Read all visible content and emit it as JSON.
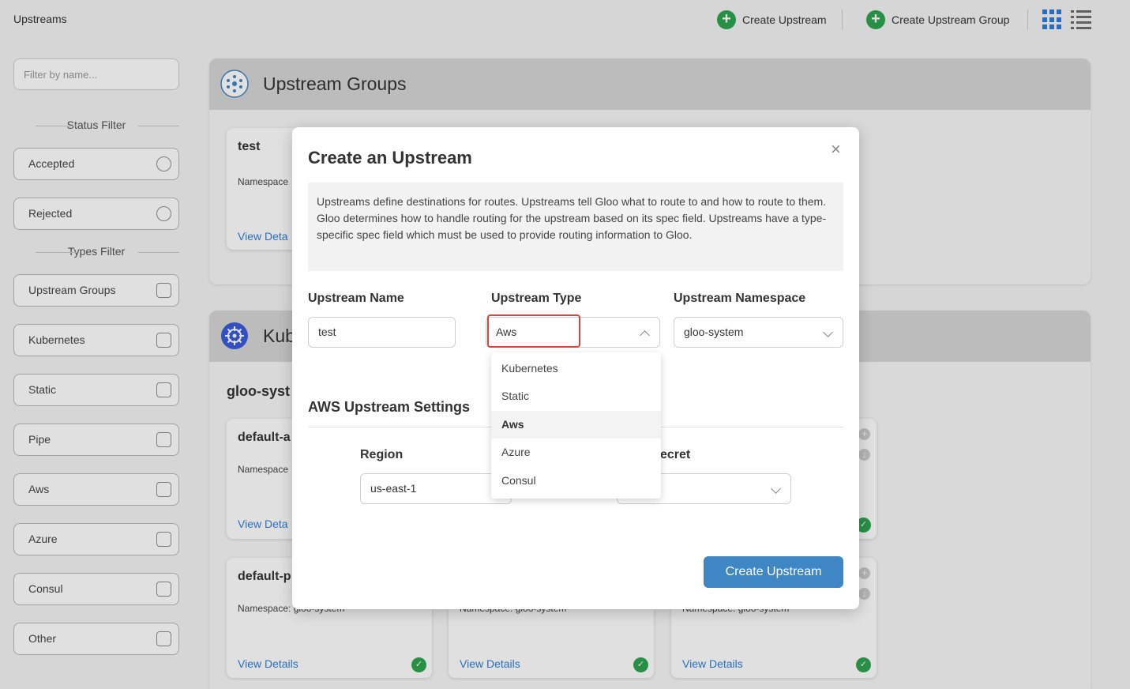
{
  "header": {
    "title": "Upstreams",
    "create_upstream": "Create Upstream",
    "create_upstream_group": "Create Upstream Group"
  },
  "sidebar": {
    "filter_placeholder": "Filter by name...",
    "status_filter_label": "Status Filter",
    "status_filters": [
      "Accepted",
      "Rejected"
    ],
    "types_filter_label": "Types Filter",
    "type_filters": [
      "Upstream Groups",
      "Kubernetes",
      "Static",
      "Pipe",
      "Aws",
      "Azure",
      "Consul",
      "Other"
    ]
  },
  "main": {
    "groups_panel": {
      "title": "Upstream Groups",
      "card": {
        "name": "test",
        "namespace": "Namespace",
        "link": "View Deta"
      }
    },
    "kube_panel": {
      "title": "Kub",
      "namespace_heading": "gloo-syst",
      "cards_row1": [
        {
          "name": "default-a",
          "namespace": "Namespace",
          "link": "View Deta"
        }
      ],
      "cards_row2": [
        {
          "name": "default-p",
          "namespace": "Namespace: gloo-system",
          "link": "View Details"
        },
        {
          "name": "",
          "namespace": "Namespace: gloo-system",
          "link": "View Details"
        },
        {
          "name": "",
          "namespace": "Namespace: gloo-system",
          "link": "View Details"
        }
      ]
    }
  },
  "modal": {
    "title": "Create an Upstream",
    "close_glyph": "×",
    "description": "Upstreams define destinations for routes. Upstreams tell Gloo what to route to and how to route to them. Gloo determines how to handle routing for the upstream based on its spec field. Upstreams have a type-specific spec field which must be used to provide routing information to Gloo.",
    "name_label": "Upstream Name",
    "name_value": "test",
    "type_label": "Upstream Type",
    "type_value": "Aws",
    "namespace_label": "Upstream Namespace",
    "namespace_value": "gloo-system",
    "aws_heading": "AWS Upstream Settings",
    "region_label": "Region",
    "region_value": "us-east-1",
    "secret_label_visible": "ecret",
    "create_button": "Create Upstream",
    "type_options": [
      "Kubernetes",
      "Static",
      "Aws",
      "Azure",
      "Consul"
    ],
    "selected_option": "Aws"
  },
  "colors": {
    "accent_blue": "#3e86c4",
    "link_blue": "#2f7ed8",
    "ok_green": "#2ea44f",
    "highlight_red": "#d9453b"
  }
}
